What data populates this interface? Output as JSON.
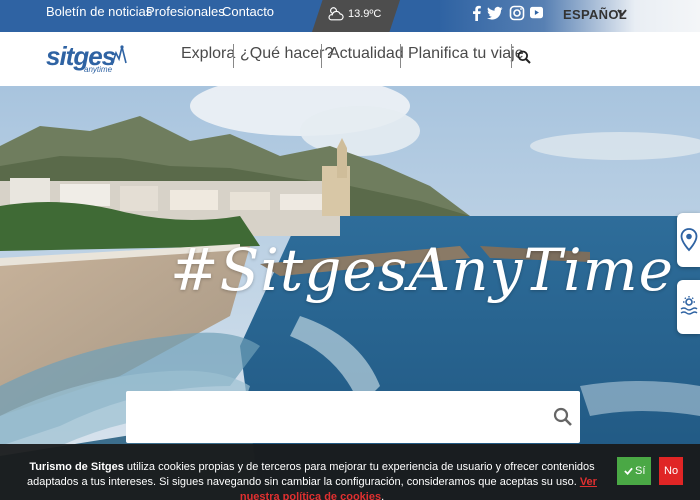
{
  "topbar": {
    "links": [
      "Boletín de noticias",
      "Profesionales",
      "Contacto"
    ],
    "weather": {
      "icon": "cloud-sun-icon",
      "temperature": "13.9ºC"
    },
    "social": [
      "facebook-icon",
      "twitter-icon",
      "instagram-icon",
      "youtube-icon"
    ],
    "language": "ESPAÑOL"
  },
  "nav": {
    "logo_text": "sitges",
    "logo_sub": "anytime",
    "items": [
      "Explora",
      "¿Qué hacer?",
      "Actualidad",
      "Planifica tu viaje"
    ]
  },
  "hero": {
    "hashtag": "#SitgesAnyTime",
    "search_placeholder": ""
  },
  "cookie": {
    "brand": "Turismo de Sitges",
    "text": " utiliza cookies propias y de terceros para mejorar tu experiencia de usuario y ofrecer contenidos adaptados a tus intereses. Si sigues navegando sin cambiar la configuración, consideramos que aceptas su uso. ",
    "link": "Ver nuestra política de cookies",
    "end": ".",
    "accept": "Sí",
    "reject": "No"
  },
  "colors": {
    "brand_blue": "#2f63a3",
    "accept_green": "#4aa845",
    "reject_red": "#e02525"
  }
}
